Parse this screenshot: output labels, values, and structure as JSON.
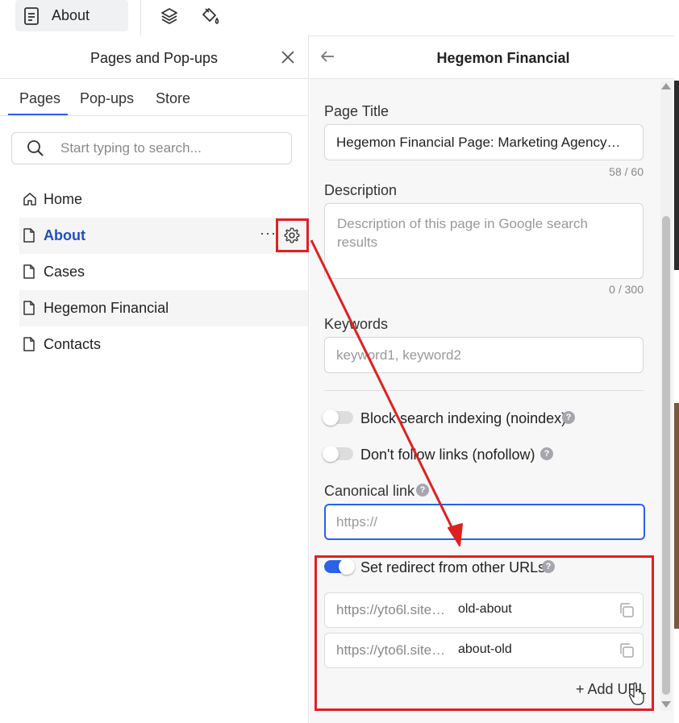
{
  "toolbar": {
    "current_page": "About",
    "icons": [
      "document-icon",
      "layers-icon",
      "paint-bucket-icon"
    ]
  },
  "left_panel": {
    "title": "Pages and Pop-ups",
    "tabs": [
      {
        "label": "Pages",
        "active": true
      },
      {
        "label": "Pop-ups",
        "active": false
      },
      {
        "label": "Store",
        "active": false
      }
    ],
    "search": {
      "placeholder": "Start typing to search..."
    },
    "pages": [
      {
        "label": "Home",
        "icon": "home-icon"
      },
      {
        "label": "About",
        "icon": "document-icon",
        "selected": true
      },
      {
        "label": "Cases",
        "icon": "document-icon"
      },
      {
        "label": "Hegemon Financial",
        "icon": "document-icon"
      },
      {
        "label": "Contacts",
        "icon": "document-icon"
      }
    ],
    "more_label": "···"
  },
  "right_panel": {
    "title": "Hegemon Financial",
    "page_title": {
      "label": "Page Title",
      "value": "Hegemon Financial Page: Marketing Agency…",
      "counter": "58 / 60"
    },
    "description": {
      "label": "Description",
      "placeholder": "Description of this page in Google search results",
      "counter": "0 / 300"
    },
    "keywords": {
      "label": "Keywords",
      "placeholder": "keyword1, keyword2"
    },
    "noindex": {
      "label": "Block search indexing (noindex)",
      "on": false
    },
    "nofollow": {
      "label": "Don't follow links (nofollow)",
      "on": false
    },
    "canonical": {
      "label": "Canonical link",
      "placeholder": "https://"
    },
    "redirect": {
      "label": "Set redirect from other URLs",
      "on": true,
      "urls": [
        {
          "prefix": "https://yto6l.site…",
          "slug": "old-about"
        },
        {
          "prefix": "https://yto6l.site…",
          "slug": "about-old"
        }
      ],
      "add_label": "+ Add URL"
    },
    "help_glyph": "?"
  },
  "colors": {
    "accent": "#2a62e8",
    "annotation": "#e02020"
  }
}
